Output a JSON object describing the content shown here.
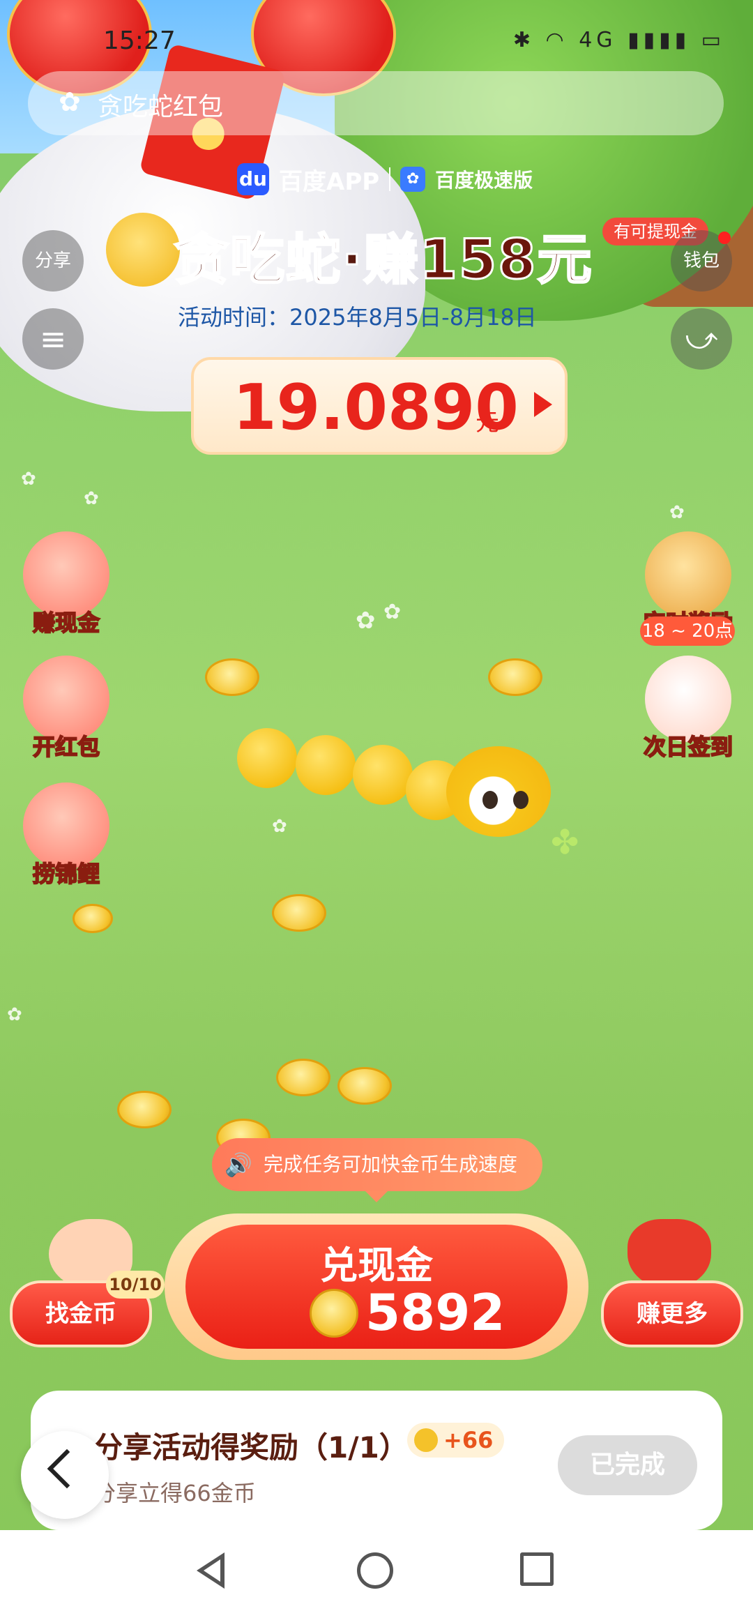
{
  "status_bar": {
    "time": "15:27",
    "right_icons": "✱ ◠ 4G ▮▮▮▮ ▭"
  },
  "search_bar": {
    "label": "贪吃蛇红包"
  },
  "app_badges": {
    "logo_text": "du",
    "app1": "百度APP",
    "app2": "百度极速版"
  },
  "title": {
    "prefix": "贪吃蛇·赚",
    "amount": "158元"
  },
  "cash_tip": "有可提现金",
  "duration": "活动时间：2025年8月5日-8月18日",
  "left_top_buttons": {
    "share": "分享",
    "menu_icon": "≡"
  },
  "right_top_buttons": {
    "wallet": "钱包",
    "route_icon": "⤻"
  },
  "balance": {
    "value": "19.0890",
    "unit": "元"
  },
  "left_features": [
    {
      "label": "赚现金"
    },
    {
      "label": "开红包"
    },
    {
      "label": "捞锦鲤"
    }
  ],
  "right_features": [
    {
      "label": "定时奖励",
      "extra": "18 ~ 20点"
    },
    {
      "label": "次日签到"
    }
  ],
  "tip": {
    "icon": "🔊",
    "text": "完成任务可加快金币生成速度"
  },
  "main_button": {
    "label": "兑现金",
    "coins": "5892"
  },
  "find_coins": {
    "label": "找金币",
    "badge": "10/10"
  },
  "earn_more": {
    "label": "赚更多"
  },
  "task_card": {
    "title": "分享活动得奖励（1/1）",
    "reward": "+66",
    "subtitle": "分享立得66金币",
    "status": "已完成"
  },
  "colors": {
    "accent_red": "#e8241c",
    "grass": "#8fd06a",
    "title_brown": "#5a1a10",
    "date_blue": "#1e57a6"
  }
}
